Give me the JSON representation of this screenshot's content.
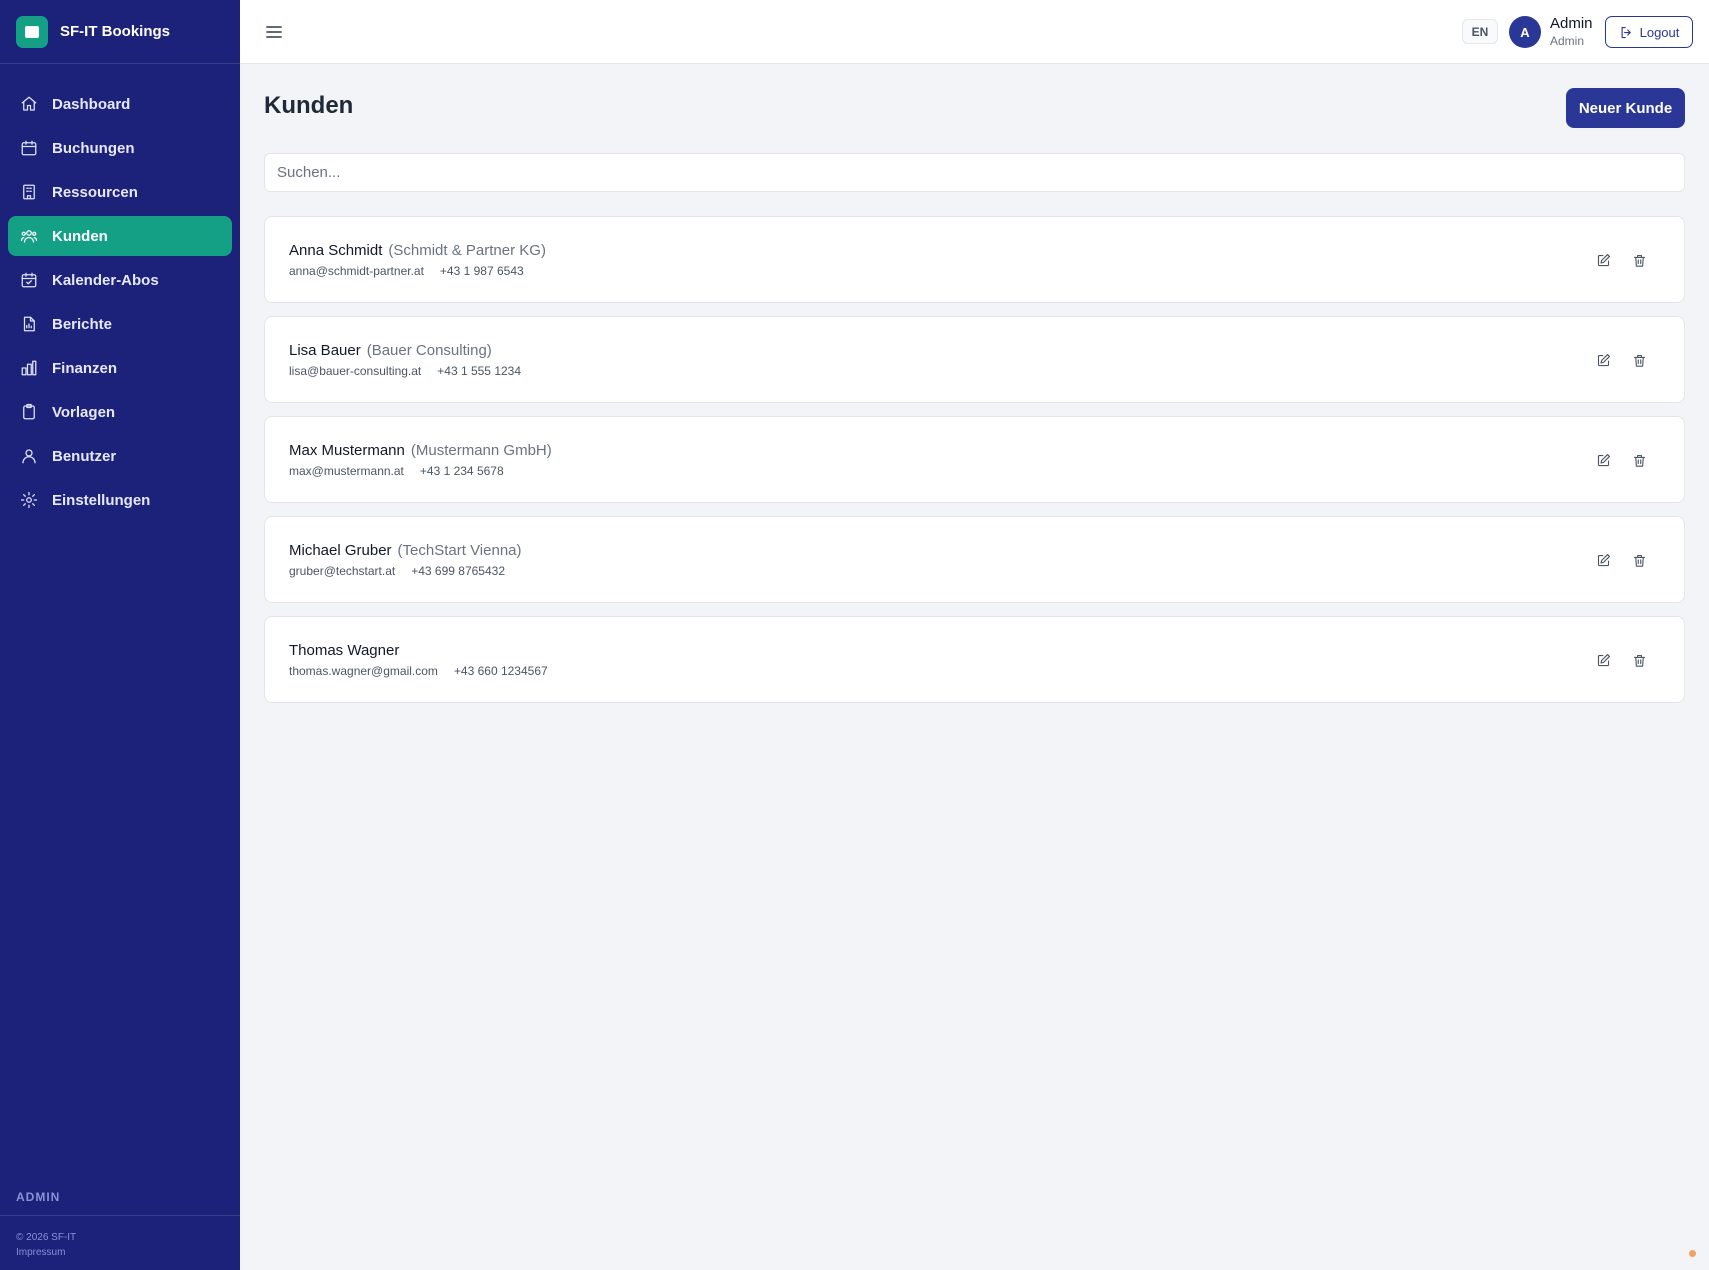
{
  "app": {
    "brand": "SF-IT Bookings"
  },
  "sidebar": {
    "items": [
      {
        "label": "Dashboard",
        "icon": "home-icon"
      },
      {
        "label": "Buchungen",
        "icon": "calendar-icon"
      },
      {
        "label": "Ressourcen",
        "icon": "building-icon"
      },
      {
        "label": "Kunden",
        "icon": "users-icon",
        "active": true
      },
      {
        "label": "Kalender-Abos",
        "icon": "calendar-check-icon"
      },
      {
        "label": "Berichte",
        "icon": "report-icon"
      },
      {
        "label": "Finanzen",
        "icon": "bar-chart-icon"
      },
      {
        "label": "Vorlagen",
        "icon": "clipboard-icon"
      },
      {
        "label": "Benutzer",
        "icon": "user-icon"
      },
      {
        "label": "Einstellungen",
        "icon": "gear-icon"
      }
    ],
    "role": "ADMIN",
    "copyright": "© 2026 SF-IT",
    "imprint": "Impressum"
  },
  "header": {
    "language": "EN",
    "avatar_initial": "A",
    "user_name": "Admin",
    "user_role": "Admin",
    "logout_label": "Logout"
  },
  "main": {
    "title": "Kunden",
    "new_button": "Neuer Kunde",
    "search_placeholder": "Suchen...",
    "customers": [
      {
        "name": "Anna Schmidt",
        "company": "(Schmidt & Partner KG)",
        "email": "anna@schmidt-partner.at",
        "phone": "+43 1 987 6543"
      },
      {
        "name": "Lisa Bauer",
        "company": "(Bauer Consulting)",
        "email": "lisa@bauer-consulting.at",
        "phone": "+43 1 555 1234"
      },
      {
        "name": "Max Mustermann",
        "company": "(Mustermann GmbH)",
        "email": "max@mustermann.at",
        "phone": "+43 1 234 5678"
      },
      {
        "name": "Michael Gruber",
        "company": "(TechStart Vienna)",
        "email": "gruber@techstart.at",
        "phone": "+43 699 8765432"
      },
      {
        "name": "Thomas Wagner",
        "company": "",
        "email": "thomas.wagner@gmail.com",
        "phone": "+43 660 1234567"
      }
    ]
  },
  "colors": {
    "sidebar_bg": "#1c2179",
    "accent": "#13a085",
    "primary": "#2b3796",
    "page_bg": "#f3f4f8"
  }
}
